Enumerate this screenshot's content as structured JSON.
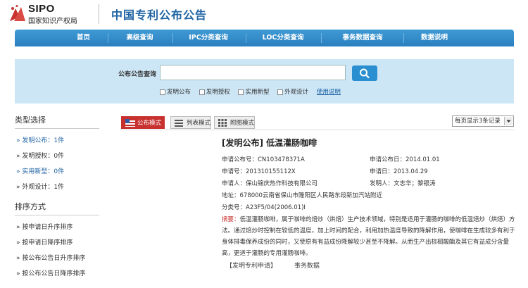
{
  "header": {
    "logo_text": "SIPO",
    "logo_cn": "国家知识产权局",
    "site_title": "中国专利公布公告"
  },
  "nav": {
    "items": [
      "首页",
      "高级查询",
      "IPC分类查询",
      "LOC分类查询",
      "事务数据查询",
      "数据说明"
    ]
  },
  "search": {
    "label": "公布公告查询",
    "input_value": "",
    "checkboxes": [
      "发明公布",
      "发明授权",
      "实用新型",
      "外观设计"
    ],
    "help_link": "使用说明"
  },
  "sidebar": {
    "type_heading": "类型选择",
    "type_items": [
      "» 发明公布：1件",
      "» 发明授权：0件",
      "» 实用新型：0件",
      "» 外观设计：1件"
    ],
    "sort_heading": "排序方式",
    "sort_items": [
      "» 按申请日升序排序",
      "» 按申请日降序排序",
      "» 按公布公告日升序排序",
      "» 按公布公告日降序排序"
    ]
  },
  "view_tabs": [
    "公布模式",
    "列表模式",
    "附图模式"
  ],
  "per_page": "每页显示3条记录",
  "result": {
    "title": "[发明公布] 低温灌肠咖啡",
    "pub_no": "申请公布号：CN103478371A",
    "pub_date": "申请公布日：2014.01.01",
    "app_no": "申请号：201310155112X",
    "app_date": "申请日：2013.04.29",
    "applicant": "申请人：保山锦庆热作科技有限公司",
    "inventor": "发明人：文志华；黎银涛",
    "address": "地址：678000云南省保山市隆阳区人民路东段新加汽站附近",
    "ipc": "分类号：A23F5/04(2006.01)I",
    "abstract_label": "摘要：",
    "abstract_text": "低温灌肠咖啡，属于咖啡的焙炒（烘焙）生产技术领域，特别是适用于灌肠的咖啡的低温焙炒（烘焙）方法。通过焙炒时控制在较低的温度，加上时间的配合，利用加热温度导致的降解作用，使咖啡在生成较多有利于身体排毒保养成份的同时，又使原有有益成份降解较少甚至不降解。从而生产出棕榈酸酯及其它有益成分含量高，更适于灌肠的专用灌肠咖啡。",
    "link_detail": "【发明专利申请】",
    "link_affairs": "事务数据"
  },
  "colors": {
    "nav_bg": "#2a7fbf",
    "search_bg": "#cde6f6",
    "accent_red": "#c7322f",
    "title_blue": "#1f63a3"
  }
}
